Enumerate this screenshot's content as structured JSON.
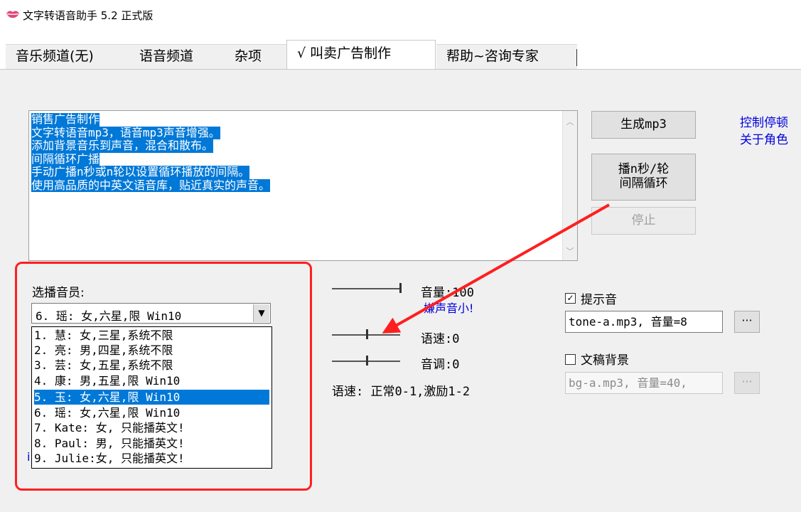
{
  "window": {
    "title": "文字转语音助手 5.2 正式版"
  },
  "tabs": [
    {
      "label": "音乐频道(无)",
      "active": false
    },
    {
      "label": "语音频道",
      "active": false
    },
    {
      "label": "杂项",
      "active": false
    },
    {
      "label": "√ 叫卖广告制作",
      "active": true
    },
    {
      "label": "帮助~咨询专家",
      "active": false
    }
  ],
  "editor": {
    "lines": [
      "销售广告制作",
      "文字转语音mp3，语音mp3声音增强。",
      "添加背景音乐到声音，混合和散布。",
      "间隔循环广播",
      "手动广播n秒或n轮以设置循环播放的间隔。",
      "使用高品质的中英文语音库，贴近真实的声音。"
    ]
  },
  "buttons": {
    "generate": "生成mp3",
    "loop_line1": "播n秒/轮",
    "loop_line2": "间隔循环",
    "stop": "停止"
  },
  "right_links": {
    "line1": "控制停顿",
    "line2": "关于角色"
  },
  "voice": {
    "label": "选播音员:",
    "selected": "6. 瑶: 女,六星,限 Win10",
    "options": [
      "1. 慧: 女,三星,系统不限",
      "2. 亮: 男,四星,系统不限",
      "3. 芸: 女,五星,系统不限",
      "4. 康: 男,五星,限 Win10",
      "5. 玉: 女,六星,限 Win10",
      "6. 瑶: 女,六星,限 Win10",
      "7. Kate: 女, 只能播英文!",
      "8. Paul: 男, 只能播英文!",
      "9. Julie:女, 只能播英文!"
    ],
    "highlighted_index": 4
  },
  "left_edge_text": "i",
  "sliders": {
    "volume": {
      "label": "音量:100",
      "level": 1.0
    },
    "volume_hint": "嫌声音小!",
    "speed": {
      "label": "语速:0",
      "level": 0.5
    },
    "pitch": {
      "label": "音调:0",
      "level": 0.5
    },
    "speed_note": "语速: 正常0-1,激励1-2"
  },
  "options": {
    "tone": {
      "label": "提示音",
      "checked": true,
      "value": "tone-a.mp3, 音量=8",
      "browse": "···"
    },
    "bg": {
      "label": "文稿背景",
      "checked": false,
      "value": "bg-a.mp3, 音量=40,",
      "browse": "···"
    }
  },
  "colors": {
    "highlight": "#0078d7",
    "annotation": "#ff1f1f",
    "link": "#0000e0"
  }
}
